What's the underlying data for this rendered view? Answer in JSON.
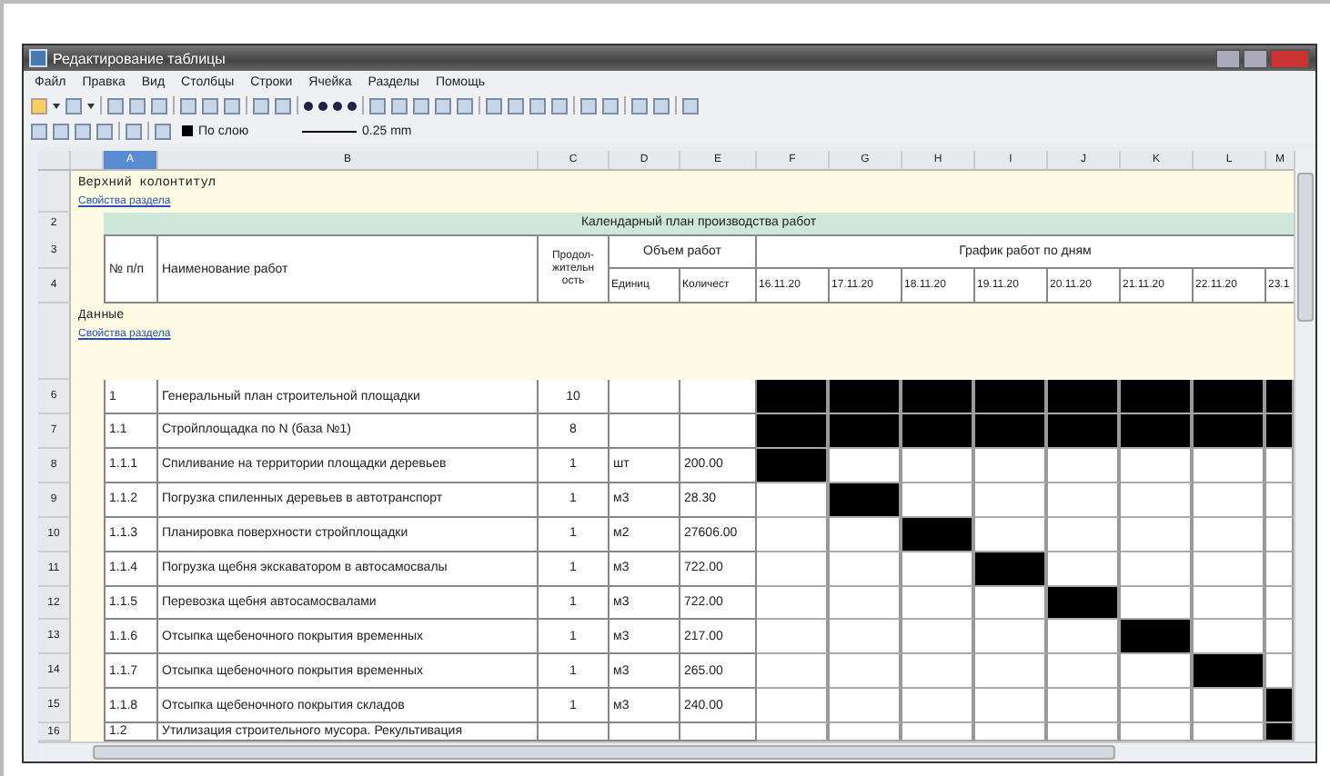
{
  "window": {
    "title": "Редактирование таблицы"
  },
  "menu": [
    "Файл",
    "Правка",
    "Вид",
    "Столбцы",
    "Строки",
    "Ячейка",
    "Разделы",
    "Помощь"
  ],
  "toolbar": {
    "layer": "По слою",
    "line_width": "0.25 mm"
  },
  "columns": [
    {
      "label": "A",
      "selected": true
    },
    {
      "label": "B",
      "selected": false
    },
    {
      "label": "C",
      "selected": false
    },
    {
      "label": "D",
      "selected": false
    },
    {
      "label": "E",
      "selected": false
    },
    {
      "label": "F",
      "selected": false
    },
    {
      "label": "G",
      "selected": false
    },
    {
      "label": "H",
      "selected": false
    },
    {
      "label": "I",
      "selected": false
    },
    {
      "label": "J",
      "selected": false
    },
    {
      "label": "K",
      "selected": false
    },
    {
      "label": "L",
      "selected": false
    },
    {
      "label": "M",
      "selected": false
    }
  ],
  "header_section": {
    "title": "Верхний колонтитул",
    "link": "Свойства раздела"
  },
  "plan_title": {
    "row": "2",
    "text": "Календарный план производства работ"
  },
  "table_header": {
    "rows": [
      "3",
      "4"
    ],
    "number": "№ п/п",
    "name": "Наименование работ",
    "duration": "Продол-жительн ость",
    "volume": "Объем работ",
    "unit": "Единиц",
    "quantity": "Количест",
    "schedule": "График работ по дням",
    "dates": [
      "16.11.20",
      "17.11.20",
      "18.11.20",
      "19.11.20",
      "20.11.20",
      "21.11.20",
      "22.11.20",
      "23.1"
    ]
  },
  "data_section": {
    "title": "Данные",
    "link": "Свойства раздела"
  },
  "rows": [
    {
      "row": "6",
      "number": "1",
      "name": "Генеральный план строительной площадки",
      "duration": "10",
      "schedule": [
        true,
        true,
        true,
        true,
        true,
        true,
        true,
        true
      ]
    },
    {
      "row": "7",
      "number": "1.1",
      "name": "Стройплощадка по N (база №1)",
      "duration": "8",
      "schedule": [
        true,
        true,
        true,
        true,
        true,
        true,
        true,
        true
      ]
    },
    {
      "row": "8",
      "number": "1.1.1",
      "name": "Спиливание на территории площадки деревьев",
      "duration": "1",
      "unit": "шт",
      "quantity": "200.00",
      "schedule": [
        true,
        false,
        false,
        false,
        false,
        false,
        false,
        false
      ]
    },
    {
      "row": "9",
      "number": "1.1.2",
      "name": "Погрузка спиленных деревьев в автотранспорт",
      "duration": "1",
      "unit": "м3",
      "quantity": "28.30",
      "schedule": [
        false,
        true,
        false,
        false,
        false,
        false,
        false,
        false
      ]
    },
    {
      "row": "10",
      "number": "1.1.3",
      "name": "Планировка поверхности стройплощадки",
      "duration": "1",
      "unit": "м2",
      "quantity": "27606.00",
      "schedule": [
        false,
        false,
        true,
        false,
        false,
        false,
        false,
        false
      ]
    },
    {
      "row": "11",
      "number": "1.1.4",
      "name": "Погрузка щебня экскаватором в автосамосвалы",
      "duration": "1",
      "unit": "м3",
      "quantity": "722.00",
      "schedule": [
        false,
        false,
        false,
        true,
        false,
        false,
        false,
        false
      ]
    },
    {
      "row": "12",
      "number": "1.1.5",
      "name": "Перевозка щебня автосамосвалами",
      "duration": "1",
      "unit": "м3",
      "quantity": "722.00",
      "schedule": [
        false,
        false,
        false,
        false,
        true,
        false,
        false,
        false
      ]
    },
    {
      "row": "13",
      "number": "1.1.6",
      "name": "Отсыпка щебеночного покрытия временных",
      "duration": "1",
      "unit": "м3",
      "quantity": "217.00",
      "schedule": [
        false,
        false,
        false,
        false,
        false,
        true,
        false,
        false
      ]
    },
    {
      "row": "14",
      "number": "1.1.7",
      "name": "Отсыпка щебеночного покрытия временных",
      "duration": "1",
      "unit": "м3",
      "quantity": "265.00",
      "schedule": [
        false,
        false,
        false,
        false,
        false,
        false,
        true,
        false
      ]
    },
    {
      "row": "15",
      "number": "1.1.8",
      "name": "Отсыпка щебеночного покрытия складов",
      "duration": "1",
      "unit": "м3",
      "quantity": "240.00",
      "schedule": [
        false,
        false,
        false,
        false,
        false,
        false,
        false,
        true
      ]
    },
    {
      "row": "16",
      "number": "1.2",
      "name": "Утилизация строительного мусора. Рекультивация",
      "schedule": [
        false,
        false,
        false,
        false,
        false,
        false,
        false,
        true
      ]
    }
  ]
}
